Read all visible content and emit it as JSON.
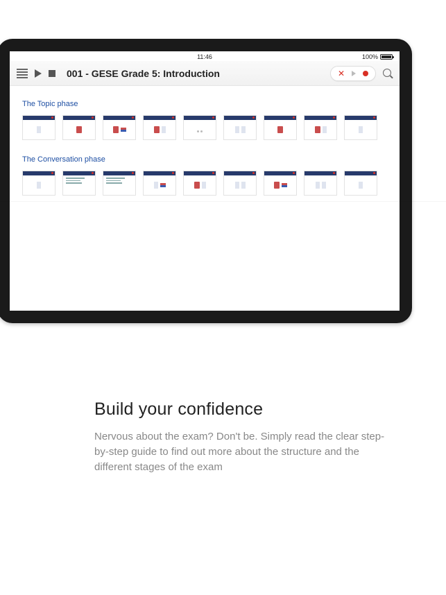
{
  "statusbar": {
    "time": "11:46",
    "battery_text": "100%"
  },
  "toolbar": {
    "title": "001 - GESE Grade 5: Introduction"
  },
  "sections": {
    "topic_title": "The Topic phase",
    "conversation_title": "The Conversation phase"
  },
  "marketing": {
    "heading": "Build your confidence",
    "body": "Nervous about the exam? Don't be. Simply read the clear step-by-step guide to find out more about the structure and the different stages of the exam"
  }
}
